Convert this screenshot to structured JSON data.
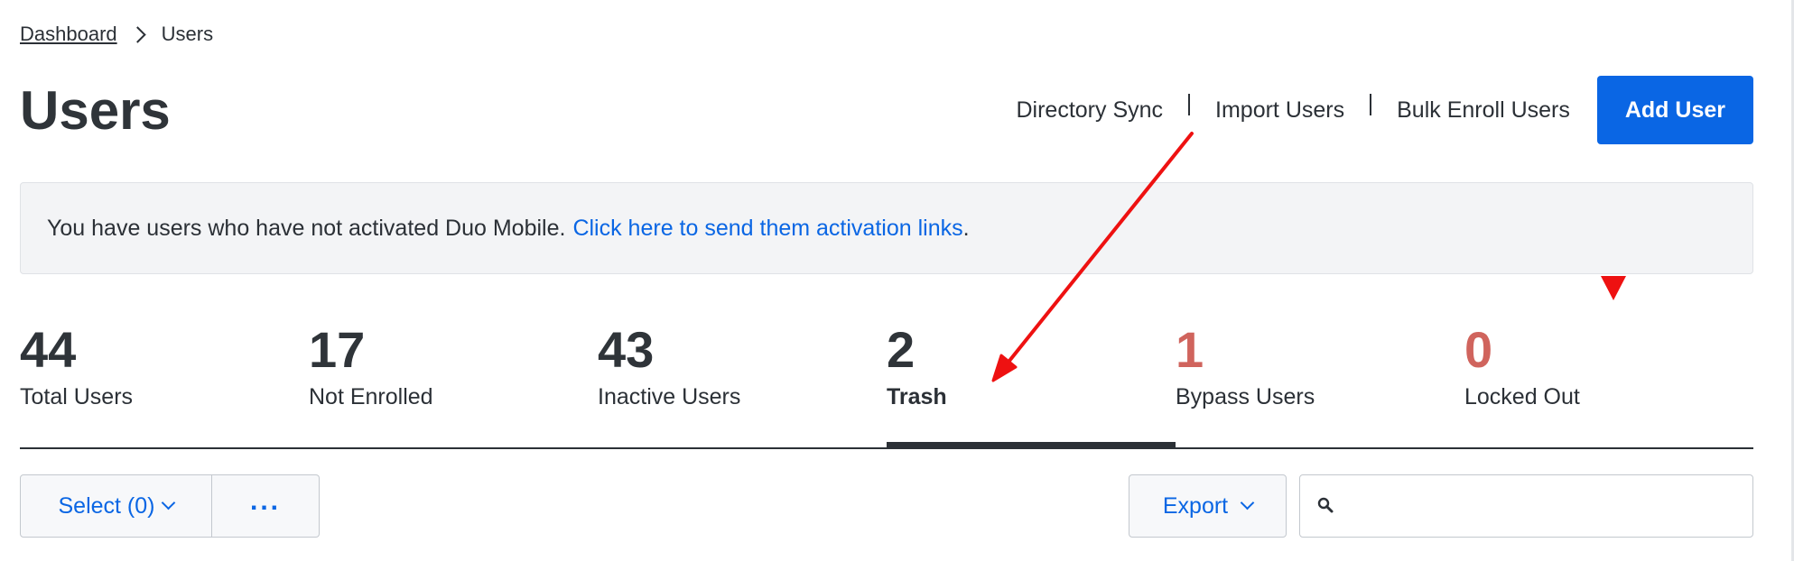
{
  "breadcrumb": {
    "items": [
      {
        "label": "Dashboard"
      },
      {
        "label": "Users"
      }
    ]
  },
  "header": {
    "title": "Users",
    "links": {
      "directory_sync": "Directory Sync",
      "import_users": "Import Users",
      "bulk_enroll": "Bulk Enroll Users"
    },
    "add_user": "Add User"
  },
  "notice": {
    "text": "You have users who have not activated Duo Mobile.",
    "link": "Click here to send them activation links",
    "end": "."
  },
  "stats": [
    {
      "value": "44",
      "label": "Total Users"
    },
    {
      "value": "17",
      "label": "Not Enrolled"
    },
    {
      "value": "43",
      "label": "Inactive Users"
    },
    {
      "value": "2",
      "label": "Trash",
      "active": true
    },
    {
      "value": "1",
      "label": "Bypass Users",
      "status": "danger"
    },
    {
      "value": "0",
      "label": "Locked Out",
      "status": "danger"
    }
  ],
  "toolbar": {
    "select_label": "Select (0)",
    "more_label": "...",
    "export_label": "Export",
    "search_value": "",
    "search_placeholder": ""
  },
  "icons": {
    "breadcrumb_separator": "chevron-right-icon",
    "dropdown": "chevron-down-icon",
    "search": "search-icon"
  },
  "colors": {
    "primary": "#0a66e4",
    "danger": "#d0645d",
    "text": "#2b3036",
    "annotation": "#ee1111"
  }
}
